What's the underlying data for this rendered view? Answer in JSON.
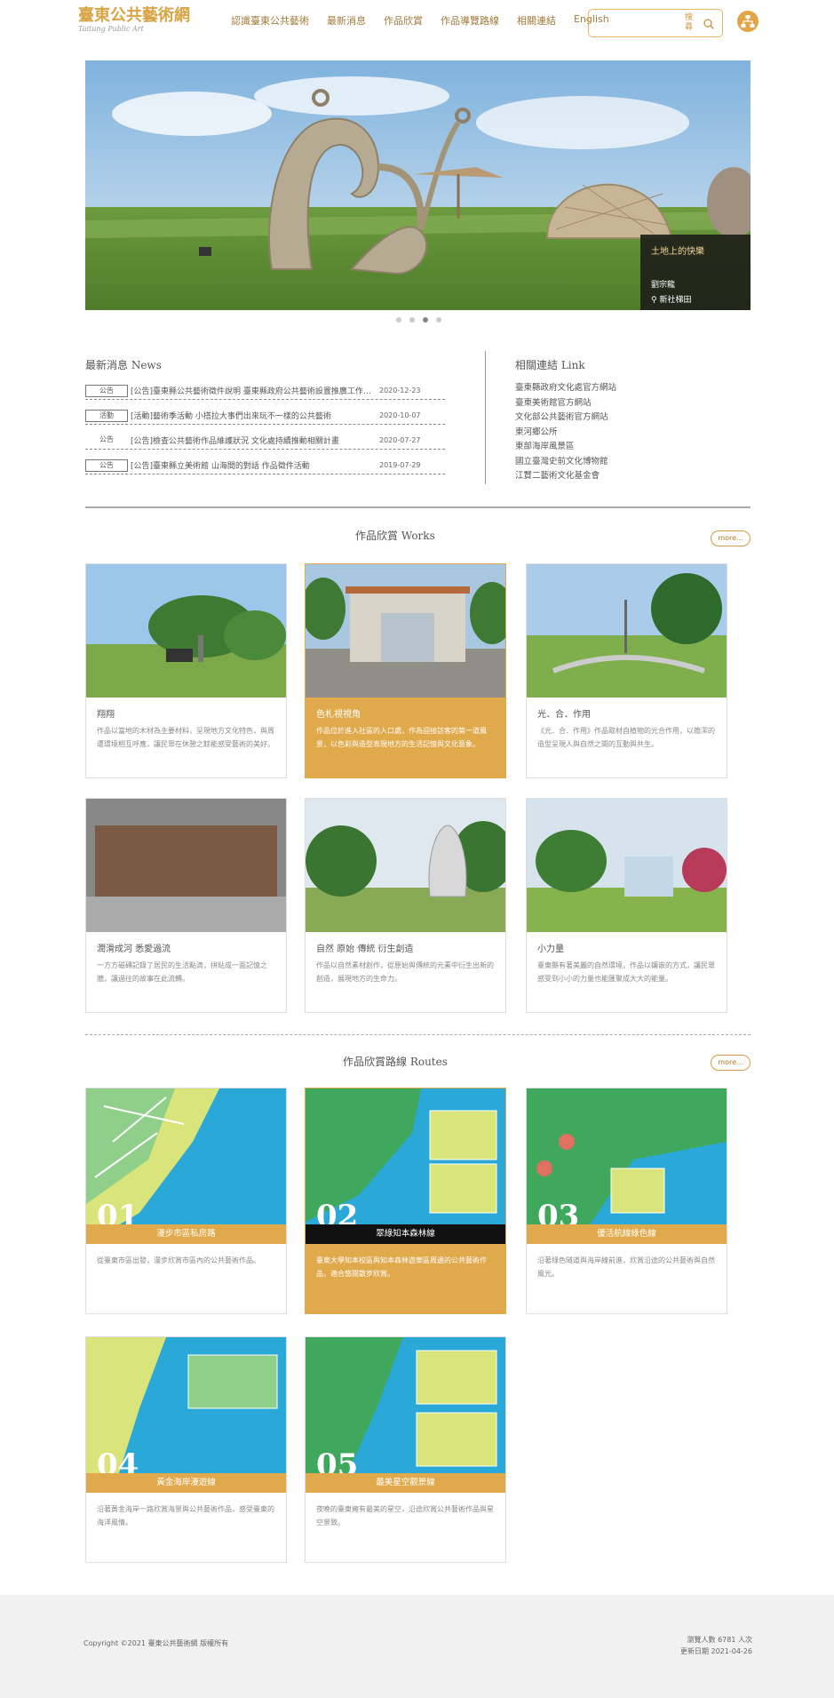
{
  "header": {
    "logo": "臺東公共藝術網",
    "logo_sub": "Taitung Public Art",
    "nav": [
      "認識臺東公共藝術",
      "最新消息",
      "作品欣賞",
      "作品導覽路線",
      "相關連結",
      "English"
    ],
    "search_placeholder": "",
    "search_label": "搜尋",
    "accent": "#d8a445"
  },
  "banner": {
    "title": "土地上的快樂",
    "artist": "劉宗龍",
    "location": "新社梯田",
    "dots": 4,
    "active_dot": 3
  },
  "news": {
    "title": "最新消息  News",
    "items": [
      {
        "badge": "公告",
        "text": "[公告]臺東縣公共藝術徵件說明 臺東縣政府公共藝術設置推廣工作計畫",
        "date": "2020-12-23"
      },
      {
        "badge": "活動",
        "text": "[活動]藝術季活動 小搭拉大事們出來玩不一樣的公共藝術",
        "date": "2020-10-07"
      },
      {
        "badge": "公告",
        "text": "[公告]檢查公共藝術作品維護狀況 文化處持續推動相關計畫",
        "date": "2020-07-27"
      },
      {
        "badge": "公告",
        "text": "[公告]臺東縣立美術館 山海間的對話 作品徵件活動",
        "date": "2019-07-29"
      }
    ]
  },
  "links": {
    "title": "相關連結  Link",
    "items": [
      "臺東縣政府文化處官方網站",
      "臺東美術館官方網站",
      "文化部公共藝術官方網站",
      "東河鄉公所",
      "東部海岸風景區",
      "國立臺灣史前文化博物館",
      "江賢二藝術文化基金會"
    ]
  },
  "works": {
    "title": "作品欣賞  Works",
    "more": "more...",
    "items": [
      {
        "title": "翔翔",
        "desc": "作品以當地的木材為主要材料，呈現地方文化特色，與周遭環境相互呼應，讓民眾在休憩之餘能感受藝術的美好。"
      },
      {
        "title": "色札視視角",
        "desc": "作品位於進入社區的入口處，作為迎接訪客的第一道風景，以色彩與造型表現地方的生活記憶與文化意象。"
      },
      {
        "title": "光．合．作用",
        "desc": "《光．合．作用》作品取材自植物的光合作用，以簡潔的造型呈現人與自然之間的互動與共生。"
      },
      {
        "title": "潤滑成河 悉愛過流",
        "desc": "一方方磁磚記錄了居民的生活點滴，拼貼成一面記憶之牆，讓過往的故事在此流轉。"
      },
      {
        "title": "自然 原始 傳統 衍生創造",
        "desc": "作品以自然素材創作，從原始與傳統的元素中衍生出新的創造，展現地方的生命力。"
      },
      {
        "title": "小力量",
        "desc": "臺東縣有著美麗的自然環境，作品以鑲嵌的方式，讓民眾感受到小小的力量也能匯聚成大大的能量。"
      }
    ]
  },
  "routes": {
    "title": "作品欣賞路線  Routes",
    "more": "more...",
    "items": [
      {
        "num": "01",
        "name": "漫步市區私房路",
        "desc": "從臺東市區出發，漫步欣賞市區內的公共藝術作品。"
      },
      {
        "num": "02",
        "name": "翠綠知本森林線",
        "desc": "臺東大學知本校區與知本森林遊樂區周邊的公共藝術作品，適合悠閒散步欣賞。"
      },
      {
        "num": "03",
        "name": "優活航線綠色線",
        "desc": "沿著綠色隧道與海岸線前進，欣賞沿途的公共藝術與自然風光。"
      },
      {
        "num": "04",
        "name": "黃金海岸漫遊線",
        "desc": "沿著黃金海岸一路欣賞海景與公共藝術作品，感受臺東的海洋風情。"
      },
      {
        "num": "05",
        "name": "最美星空觀景線",
        "desc": "夜晚的臺東擁有最美的星空，沿途欣賞公共藝術作品與星空景致。"
      }
    ]
  },
  "footer": {
    "copyright": "Copyright ©2021 臺東公共藝術網 版權所有",
    "visitors": "瀏覽人數 6781 人次",
    "updated": "更新日期 2021-04-26"
  }
}
